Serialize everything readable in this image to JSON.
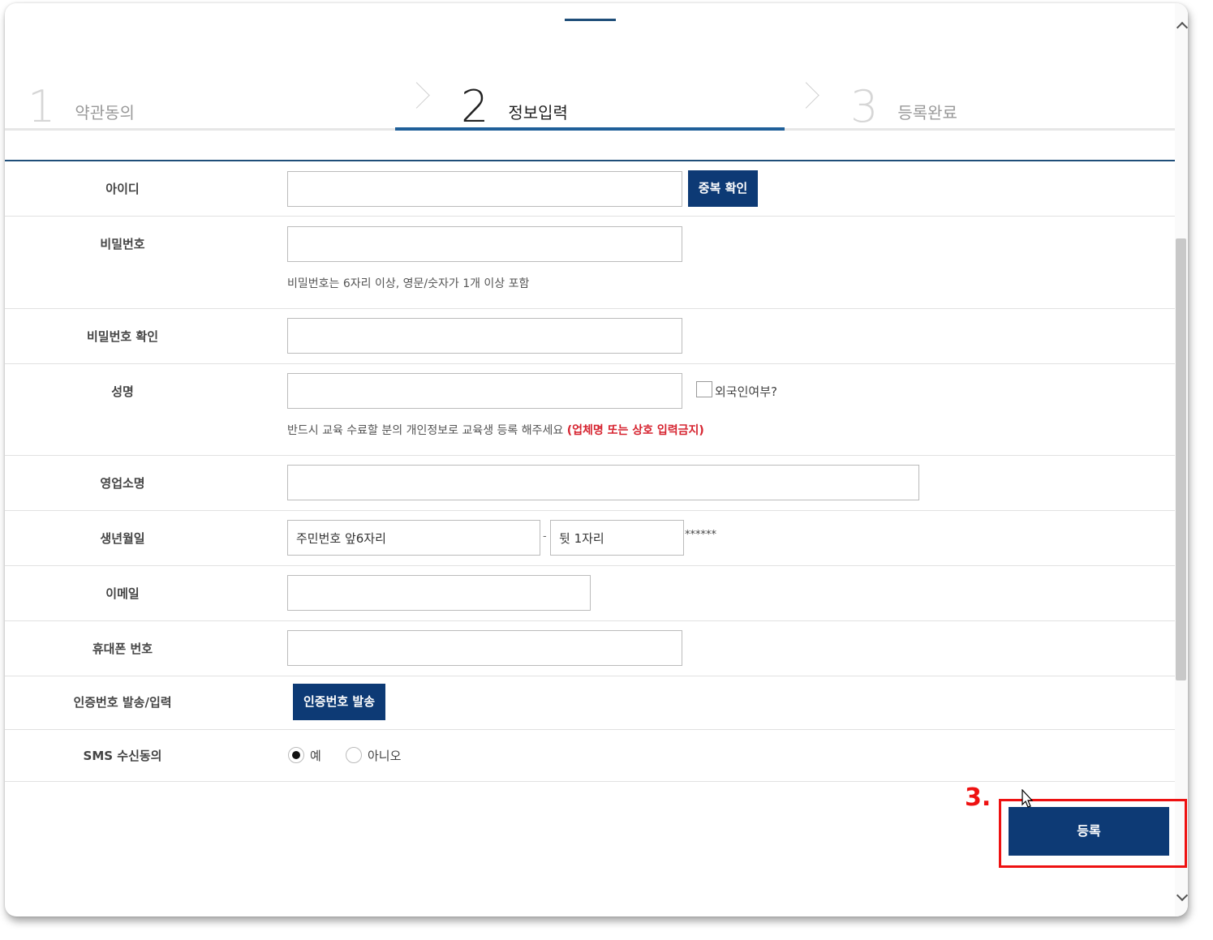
{
  "steps": [
    {
      "num": "1",
      "label": "약관동의"
    },
    {
      "num": "2",
      "label": "정보입력"
    },
    {
      "num": "3",
      "label": "등록완료"
    }
  ],
  "form": {
    "id": {
      "label": "아이디",
      "value": "",
      "check_button": "중복 확인"
    },
    "password": {
      "label": "비밀번호",
      "value": "",
      "hint": "비밀번호는 6자리 이상, 영문/숫자가 1개 이상 포함"
    },
    "password_confirm": {
      "label": "비밀번호 확인",
      "value": ""
    },
    "name": {
      "label": "성명",
      "value": "",
      "foreigner_label": "외국인여부?",
      "hint": "반드시 교육 수료할 분의 개인정보로 교육생 등록 해주세요",
      "warning": "(업체명 또는 상호 입력금지)"
    },
    "business_name": {
      "label": "영업소명",
      "value": ""
    },
    "birth": {
      "label": "생년월일",
      "front_placeholder": "주민번호 앞6자리",
      "dash": "-",
      "back_placeholder": "뒷 1자리",
      "mask": "******"
    },
    "email": {
      "label": "이메일",
      "value": ""
    },
    "phone": {
      "label": "휴대폰 번호",
      "value": ""
    },
    "auth": {
      "label": "인증번호 발송/입력",
      "button": "인증번호 발송"
    },
    "sms": {
      "label": "SMS 수신동의",
      "yes": "예",
      "no": "아니오",
      "selected": "예"
    }
  },
  "submit_label": "등록",
  "annotation": "3.",
  "colors": {
    "navy": "#0d3a75",
    "accent_line": "#1f5f99",
    "warning": "#d6232f",
    "highlight": "#e11111"
  }
}
